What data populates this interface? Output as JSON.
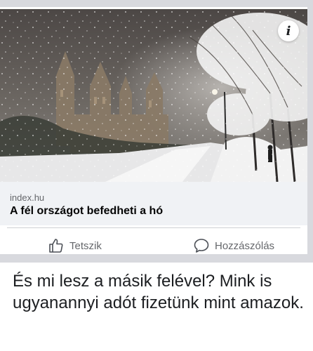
{
  "post": {
    "link_domain": "index.hu",
    "link_title": "A fél országot befedheti a hó",
    "info_glyph": "i"
  },
  "actions": {
    "like_label": "Tetszik",
    "comment_label": "Hozzászólás"
  },
  "comment": {
    "text": "És mi lesz a másik felével? Mink is ugyanannyi adót fizetünk mint amazok."
  },
  "icons": {
    "like": "thumbs-up-icon",
    "comment": "speech-bubble-icon",
    "info": "info-icon"
  },
  "colors": {
    "secondary_text": "#65676b",
    "preview_bg": "#f0f2f5"
  }
}
